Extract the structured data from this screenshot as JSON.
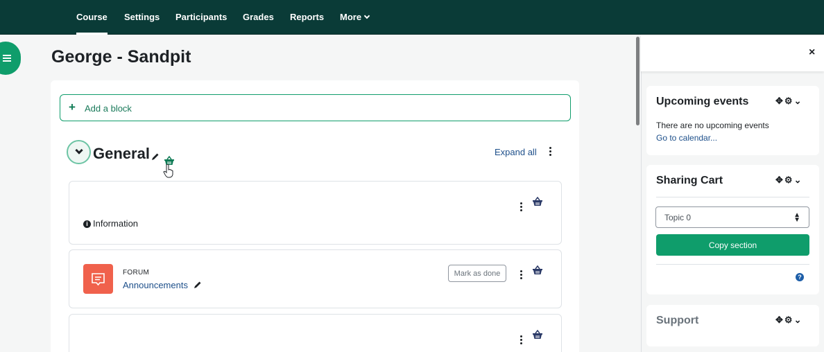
{
  "nav": {
    "tabs": [
      {
        "label": "Course",
        "active": true
      },
      {
        "label": "Settings"
      },
      {
        "label": "Participants"
      },
      {
        "label": "Grades"
      },
      {
        "label": "Reports"
      },
      {
        "label": "More"
      }
    ]
  },
  "page": {
    "title": "George - Sandpit"
  },
  "main": {
    "add_block_label": "Add a block",
    "section": {
      "title": "General",
      "expand_all_label": "Expand all"
    },
    "activities": [
      {
        "label": "Information"
      },
      {
        "type": "FORUM",
        "name": "Announcements",
        "mark_done_label": "Mark as done"
      },
      {}
    ]
  },
  "drawer": {
    "close_label": "×",
    "blocks": {
      "upcoming": {
        "title": "Upcoming events",
        "text": "There are no upcoming events",
        "link": "Go to calendar..."
      },
      "sharing": {
        "title": "Sharing Cart",
        "select_value": "Topic 0",
        "button_label": "Copy section",
        "help_label": "?"
      },
      "support": {
        "title": "Support"
      }
    }
  },
  "colors": {
    "nav_bg": "#0a3b37",
    "accent": "#0f9d6b",
    "forum_icon": "#f0614c",
    "link": "#1d4f8a"
  },
  "icons": [
    "list-icon",
    "plus-icon",
    "chevron-down-icon",
    "pencil-icon",
    "kebab-menu-icon",
    "basket-icon",
    "info-icon",
    "forum-icon",
    "move-icon",
    "gear-icon",
    "close-icon",
    "help-icon",
    "hand-cursor-icon"
  ]
}
